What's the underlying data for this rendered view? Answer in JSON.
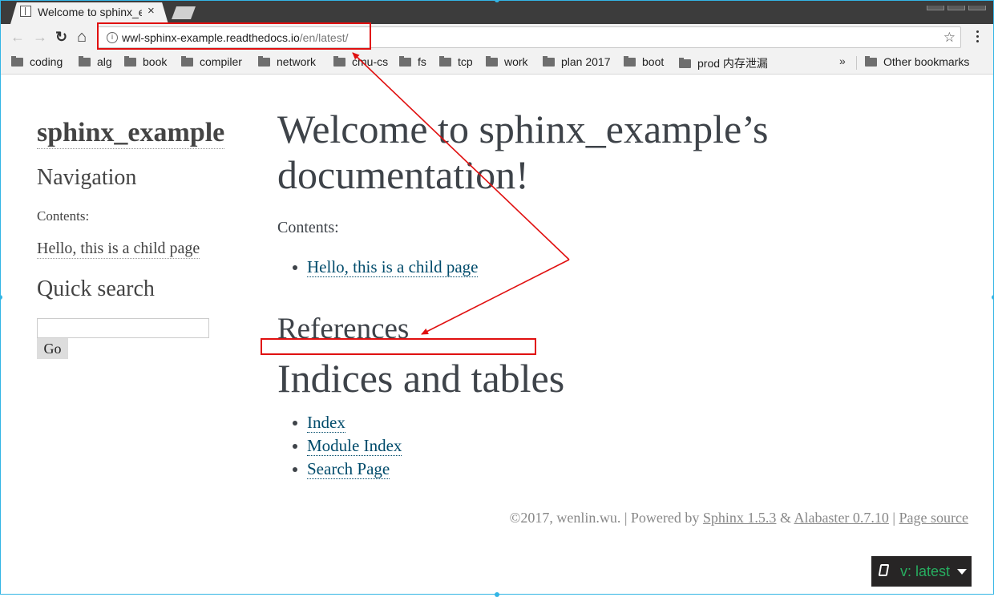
{
  "browser": {
    "tab_title": "Welcome to sphinx_example",
    "tab_close": "×",
    "url_host": "wwl-sphinx-example.readthedocs.io",
    "url_path": "/en/latest/",
    "info_glyph": "i",
    "star_glyph": "☆",
    "nav": {
      "back": "←",
      "forward": "→",
      "reload": "↻",
      "home": "⌂"
    },
    "bookmarks": [
      "coding",
      "alg",
      "book",
      "compiler",
      "network",
      "cmu-cs",
      "fs",
      "tcp",
      "work",
      "plan 2017",
      "boot",
      "prod 内存泄漏"
    ],
    "more_glyph": "»",
    "other_bookmarks": "Other bookmarks"
  },
  "sidebar": {
    "title": "sphinx_example",
    "navigation_heading": "Navigation",
    "contents_caption": "Contents:",
    "child_link": "Hello, this is a child page",
    "search_heading": "Quick search",
    "go_label": "Go"
  },
  "main": {
    "title_line1": "Welcome to sphinx_example’s",
    "title_line2": "documentation!",
    "contents_caption": "Contents:",
    "toc_link": "Hello, this is a child page",
    "references_heading": "References",
    "indices_heading": "Indices and tables",
    "index_links": [
      "Index",
      "Module Index",
      "Search Page"
    ]
  },
  "footer": {
    "copyright": "©2017, wenlin.wu. | Powered by ",
    "sphinx": "Sphinx 1.5.3",
    "amp": " & ",
    "alabaster": "Alabaster 0.7.10",
    "sep": " | ",
    "page_source": "Page source"
  },
  "rtd_badge": {
    "label": "v: latest",
    "color": "#27ae60"
  },
  "colors": {
    "annotation": "#e01010",
    "link": "#004b6b",
    "frame": "#33b5e5"
  }
}
